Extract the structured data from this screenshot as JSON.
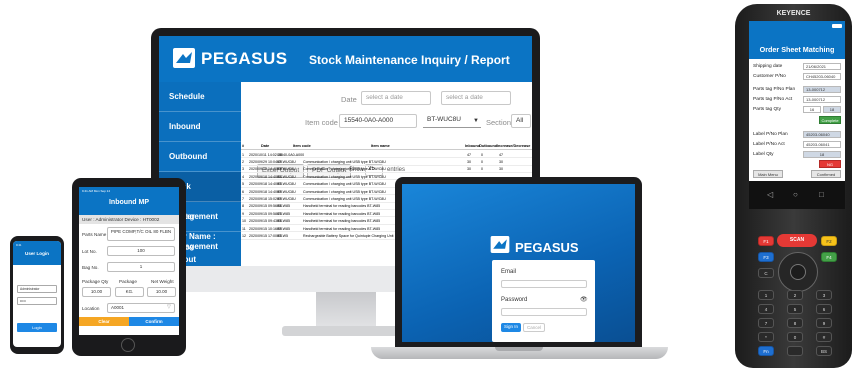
{
  "colors": {
    "brand_blue": "#0b74c4",
    "sidebar_blue": "#0b6fbd",
    "confirm_red": "#e53935",
    "confirm_green": "#43a047",
    "tablet_clear": "#f5a623",
    "tablet_confirm": "#1e88e5"
  },
  "monitor": {
    "brand": "PEGASUS",
    "title": "Stock Maintenance Inquiry / Report",
    "sidebar": [
      "Schedule",
      "Inbound",
      "Outbound",
      "Stock Management",
      "Master Management",
      "User Name :",
      "Device",
      "Logout"
    ],
    "filters": {
      "date_label": "Date",
      "date_from_placeholder": "select a date",
      "date_to_placeholder": "select a date",
      "item_code_label": "Item code",
      "item_code_value": "15540-0A0-A000",
      "item_desc_value": "BT-WUC8U",
      "section_label": "Section",
      "section_value": "All"
    },
    "actions": {
      "excel": "Excel Output",
      "pdf": "PDF Output",
      "show": "Show",
      "show_value": "25",
      "entries": "entries"
    },
    "table": {
      "headers": [
        "#",
        "Date",
        "Item code",
        "Item name",
        "Inbound",
        "Outbound",
        "Increase/Decrease"
      ],
      "rows": [
        [
          "1",
          "2020/10/11 14:02:05",
          "15540-0A0-A000",
          "",
          "47",
          "0",
          "47"
        ],
        [
          "2",
          "2020/09/29 10:04:49",
          "BT-WUC8U",
          "Communication / charging unit USB type BT-W/C8U",
          "30",
          "0",
          "30"
        ],
        [
          "3",
          "2020/09/18 14:40:09",
          "BT-WUC8U",
          "Communication / charging unit USB type BT-W/C8U",
          "30",
          "0",
          "30"
        ],
        [
          "4",
          "2020/09/18 14:40:54",
          "BT-WUC8U",
          "Communication / charging unit USB type BT-W/C8U",
          "",
          "",
          ""
        ],
        [
          "5",
          "2020/09/18 14:40:05",
          "BT-WUC8U",
          "Communication / charging unit USB type BT-W/C8U",
          "",
          "",
          ""
        ],
        [
          "6",
          "2020/09/18 14:40:09",
          "BT-WUC8U",
          "Communication / charging unit USB type BT-W/C8U",
          "",
          "",
          ""
        ],
        [
          "7",
          "2020/09/18 15:02:09",
          "BT-WUC8U",
          "Communication / charging unit USB type BT-W/C8U",
          "",
          "",
          ""
        ],
        [
          "8",
          "2020/09/15 09:56:56",
          "BT-W85",
          "Handheld terminal for reading barcodes BT-W85",
          "",
          "",
          ""
        ],
        [
          "9",
          "2020/09/15 09:58:25",
          "BT-W85",
          "Handheld terminal for reading barcodes BT-W85",
          "",
          "",
          ""
        ],
        [
          "10",
          "2020/09/15 09:43:06",
          "BT-W85",
          "Handheld terminal for reading barcodes BT-W85",
          "",
          "",
          ""
        ],
        [
          "11",
          "2020/09/15 10:16:59",
          "BT-W85",
          "Handheld terminal for reading barcodes BT-W85",
          "",
          "",
          ""
        ],
        [
          "12",
          "2020/09/15 17:00:05",
          "BT-W5",
          "Rechargeable Battery Space for Quintuple Charging Unit",
          "",
          "",
          ""
        ]
      ]
    }
  },
  "laptop": {
    "brand": "PEGASUS",
    "email_label": "Email",
    "password_label": "Password",
    "signin": "Sign In",
    "cancel": "Cancel"
  },
  "tablet": {
    "status": "9:41 AM  Mon Sep 14",
    "title": "Inbound MP",
    "user_line": "User : Administrator    Device : HT0002",
    "parts_name_label": "Parts Name",
    "parts_name_value": "PIPE COMP,T/C OIL 80 FLBN",
    "lot_label": "Lot No.",
    "lot_value": "100",
    "bag_label": "Bag No.",
    "bag_value": "1",
    "pkg_qty_label": "Package Qty",
    "pkg_label": "Package",
    "weight_label": "Net Weight",
    "pkg_qty_value": "10.00",
    "pkg_value": "KG.",
    "weight_value": "10.00",
    "location_label": "Location",
    "location_value": "A0001",
    "clear": "Clear",
    "confirm": "Confirm"
  },
  "phone": {
    "status": "9:41",
    "title": "User Login",
    "user_value": "Administrator",
    "password_value": "•••••",
    "login": "Login"
  },
  "handheld": {
    "brand": "KEYENCE",
    "title": "Order Sheet Matching",
    "shipping_date_label": "Shipping date",
    "shipping_date_value": "21/06/2021",
    "customer_label": "Customer P/No",
    "customer_value": "CH45203-06040",
    "tag_plan_label": "Parts tag P/No Plan",
    "tag_plan_value": "13-000712",
    "tag_act_label": "Parts tag P/No Act",
    "tag_act_value": "13-000712",
    "tag_qty_label": "Parts tag Qty",
    "tag_qty_a": "16",
    "tag_qty_b": "18",
    "complete": "Complete",
    "label_plan_label": "Label P/No Plan",
    "label_plan_value": "45203-06040",
    "label_act_label": "Label P/No Act",
    "label_act_value": "45203-06041",
    "label_qty_label": "Label Qty",
    "label_qty_value": "18",
    "ng": "NG",
    "main_menu": "Main Menu",
    "confirmed": "Confirmed",
    "scan": "SCAN",
    "keys": [
      "F1",
      "F2",
      "F3",
      "F4",
      "C",
      "1",
      "2",
      "3",
      "4",
      "5",
      "6",
      "7",
      "8",
      "9",
      "*",
      "0",
      "#",
      "Fn",
      "",
      "BS"
    ]
  }
}
